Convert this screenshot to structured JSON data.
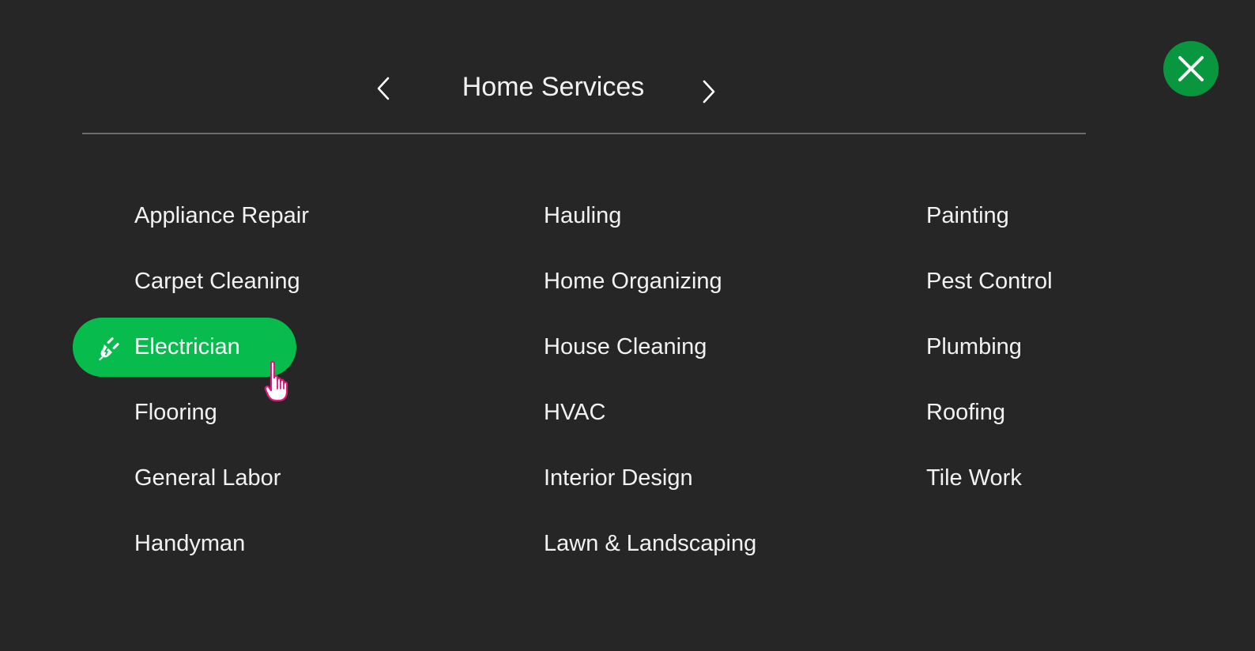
{
  "header": {
    "title": "Home Services",
    "prev_icon": "chevron-left-icon",
    "next_icon": "chevron-right-icon",
    "close_icon": "close-icon"
  },
  "colors": {
    "background": "#262626",
    "accent": "#07bc4d",
    "close_bg": "#08973f",
    "divider": "#6c6c6c"
  },
  "columns": [
    {
      "items": [
        {
          "label": "Appliance Repair"
        },
        {
          "label": "Carpet Cleaning"
        },
        {
          "label": "Electrician",
          "selected": true,
          "icon": "plug-icon"
        },
        {
          "label": "Flooring"
        },
        {
          "label": "General Labor"
        },
        {
          "label": "Handyman"
        }
      ]
    },
    {
      "items": [
        {
          "label": "Hauling"
        },
        {
          "label": "Home Organizing"
        },
        {
          "label": "House Cleaning"
        },
        {
          "label": "HVAC"
        },
        {
          "label": "Interior Design"
        },
        {
          "label": "Lawn & Landscaping"
        }
      ]
    },
    {
      "items": [
        {
          "label": "Painting"
        },
        {
          "label": "Pest Control"
        },
        {
          "label": "Plumbing"
        },
        {
          "label": "Roofing"
        },
        {
          "label": "Tile Work"
        }
      ]
    }
  ],
  "cursor_icon": "hand-pointer-icon"
}
